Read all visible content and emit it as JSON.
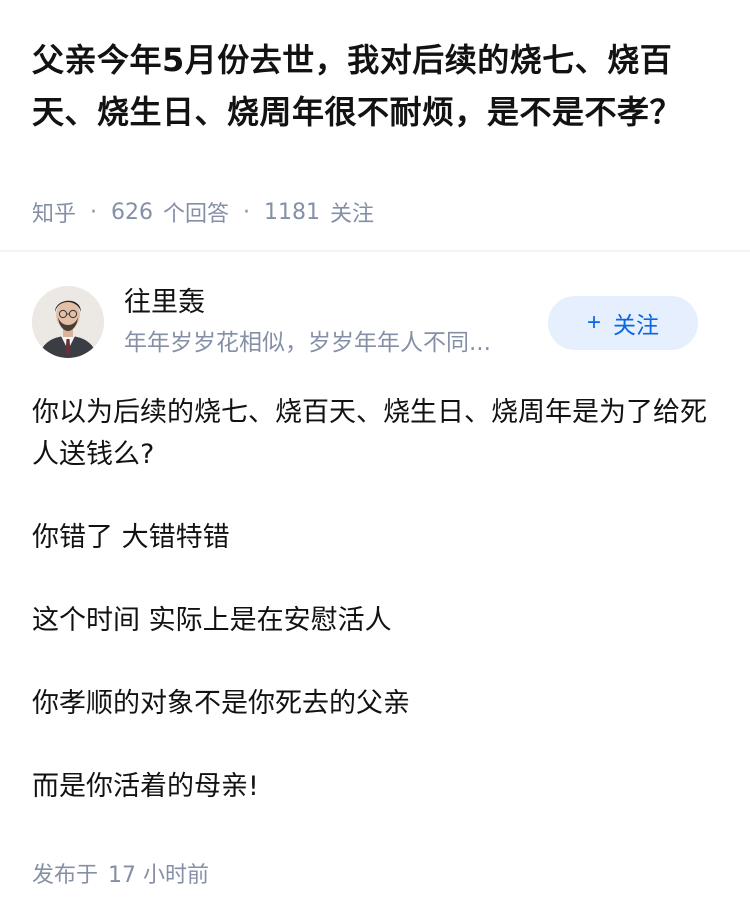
{
  "question": {
    "title": "父亲今年5月份去世，我对后续的烧七、烧百天、烧生日、烧周年很不耐烦，是不是不孝？",
    "source": "知乎",
    "answer_count": "626",
    "answer_label": "个回答",
    "follow_count": "1181",
    "follow_label": "关注"
  },
  "author": {
    "name": "往里轰",
    "bio": "年年岁岁花相似，岁岁年年人不同...",
    "follow_button": "关注",
    "follow_icon": "plus-icon"
  },
  "answer": {
    "paragraphs": [
      "你以为后续的烧七、烧百天、烧生日、烧周年是为了给死人送钱么?",
      "你错了 大错特错",
      "这个时间 实际上是在安慰活人",
      "你孝顺的对象不是你死去的父亲",
      "而是你活着的母亲!"
    ],
    "posted_prefix": "发布于",
    "posted_time": "17 小时前"
  },
  "colors": {
    "text": "#121212",
    "meta": "#8590a6",
    "accent": "#0a66e4",
    "button_bg": "#e5effd"
  }
}
